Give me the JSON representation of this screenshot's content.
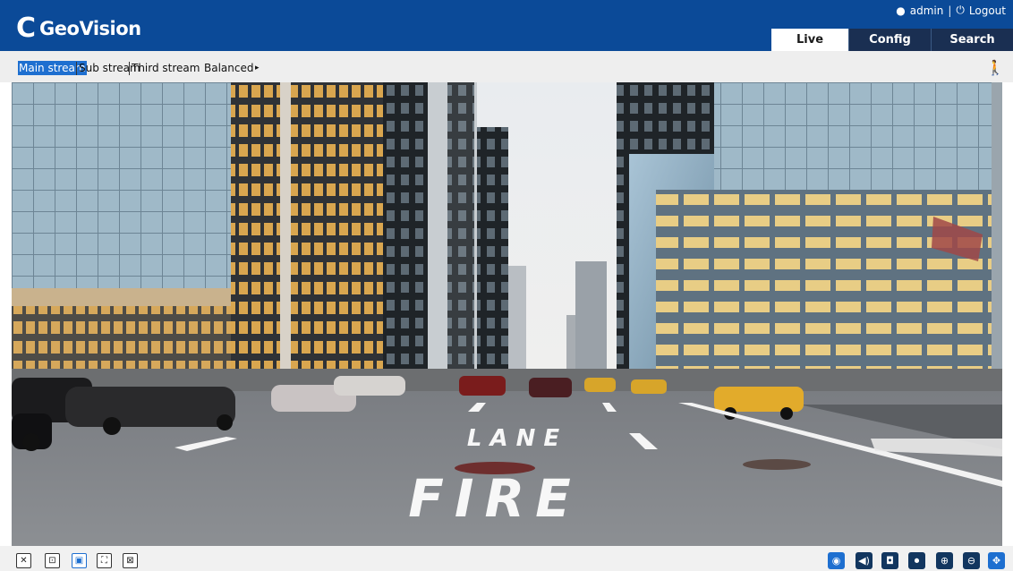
{
  "header": {
    "brand": "GeoVision",
    "brand_mark": "C",
    "user": "admin",
    "logout": "Logout",
    "separator": "|"
  },
  "tabs": [
    {
      "label": "Live",
      "active": true
    },
    {
      "label": "Config",
      "active": false
    },
    {
      "label": "Search",
      "active": false
    }
  ],
  "streams": {
    "main": "Main stream",
    "sub": "Sub stream",
    "third": "Third stream",
    "quality": "Balanced",
    "quality_arrow": "▸"
  },
  "video": {
    "painted_text_1": "LANE",
    "painted_text_2": "FIRE"
  },
  "colors": {
    "header": "#0b4a98",
    "tab_inactive": "#1a2f52",
    "accent": "#1e6fd0"
  },
  "icons": {
    "motion": "person-walking-icon",
    "left_tools": [
      "close-view-icon",
      "fit-view-icon",
      "window-icon",
      "fullscreen-icon",
      "zoom-region-icon"
    ],
    "right_tools": [
      "eye-icon",
      "audio-icon",
      "snapshot-icon",
      "record-icon",
      "zoom-in-icon",
      "zoom-out-icon",
      "ptz-icon"
    ]
  }
}
